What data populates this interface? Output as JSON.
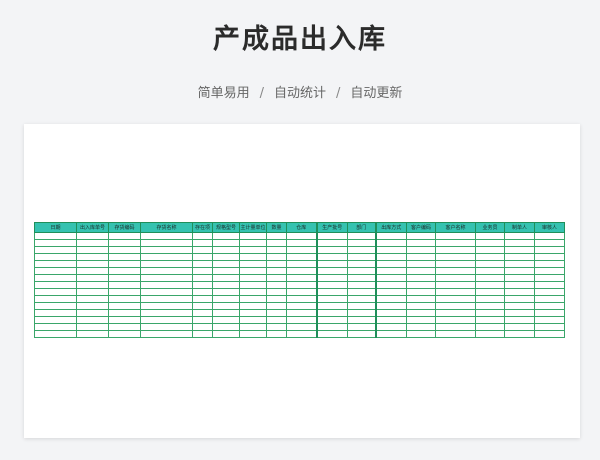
{
  "title": "产成品出入库",
  "subtitle": {
    "items": [
      "简单易用",
      "自动统计",
      "自动更新"
    ],
    "separator": "/"
  },
  "table": {
    "headers": [
      "日期",
      "出入库单号",
      "存货编码",
      "存货名称",
      "存在项",
      "规格型号",
      "主计量单位",
      "数量",
      "仓库",
      "生产批号",
      "部门",
      "出库方式",
      "客户编码",
      "客户名称",
      "业务员",
      "制单人",
      "审核人"
    ],
    "row_count": 15
  },
  "colors": {
    "header_bg": "#35c2b0",
    "grid_line": "#3aa66a",
    "page_bg": "#f3f4f6"
  }
}
